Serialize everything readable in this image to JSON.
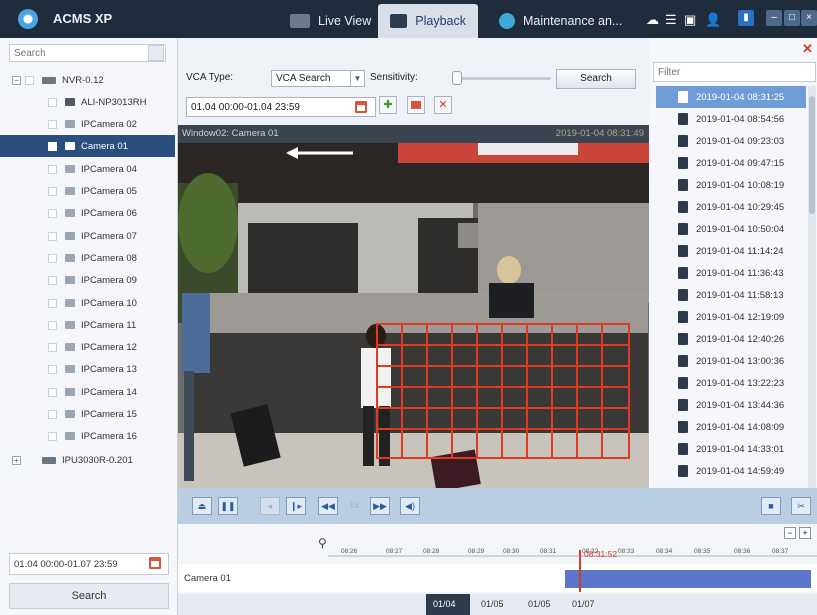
{
  "app": {
    "title": "ACMS XP"
  },
  "tabs": [
    {
      "label": "Live View"
    },
    {
      "label": "Playback"
    },
    {
      "label": "Maintenance an..."
    }
  ],
  "left": {
    "search_placeholder": "Search",
    "tree": [
      {
        "label": "NVR-0.12"
      },
      {
        "label": "ALI-NP3013RH"
      },
      {
        "label": "IPCamera 02"
      },
      {
        "label": "Camera 01"
      },
      {
        "label": "IPCamera 04"
      },
      {
        "label": "IPCamera 05"
      },
      {
        "label": "IPCamera 06"
      },
      {
        "label": "IPCamera 07"
      },
      {
        "label": "IPCamera 08"
      },
      {
        "label": "IPCamera 09"
      },
      {
        "label": "IPCamera 10"
      },
      {
        "label": "IPCamera 11"
      },
      {
        "label": "IPCamera 12"
      },
      {
        "label": "IPCamera 13"
      },
      {
        "label": "IPCamera 14"
      },
      {
        "label": "IPCamera 15"
      },
      {
        "label": "IPCamera 16"
      },
      {
        "label": "IPU3030R-0.201"
      }
    ],
    "date_range": "01.04 00:00-01.07 23:59",
    "search_button": "Search"
  },
  "vca": {
    "type_label": "VCA Type:",
    "type_value": "VCA Search",
    "sensitivity_label": "Sensitivity:",
    "search_button": "Search",
    "date_range": "01.04 00:00-01.04 23:59"
  },
  "video": {
    "window_label": "Window02: Camera 01",
    "timestamp": "2019-01-04 08:31:49"
  },
  "controls": {
    "speed": "1x"
  },
  "timeline": {
    "ticks": [
      "08:26",
      "08:27",
      "08:28",
      "08:29",
      "08:30",
      "08:31",
      "08:32",
      "08:33",
      "08:34",
      "08:35",
      "08:36",
      "08:37"
    ],
    "cursor_time": "08:31:52",
    "track_label": "Camera 01",
    "dates": [
      "01/04",
      "01/05",
      "01/05",
      "01/07"
    ]
  },
  "right": {
    "filter_placeholder": "Filter",
    "records": [
      "2019-01-04 08:31:25",
      "2019-01-04 08:54:56",
      "2019-01-04 09:23:03",
      "2019-01-04 09:47:15",
      "2019-01-04 10:08:19",
      "2019-01-04 10:29:45",
      "2019-01-04 10:50:04",
      "2019-01-04 11:14:24",
      "2019-01-04 11:36:43",
      "2019-01-04 11:58:13",
      "2019-01-04 12:19:09",
      "2019-01-04 12:40:26",
      "2019-01-04 13:00:36",
      "2019-01-04 13:22:23",
      "2019-01-04 13:44:36",
      "2019-01-04 14:08:09",
      "2019-01-04 14:33:01",
      "2019-01-04 14:59:49"
    ]
  }
}
